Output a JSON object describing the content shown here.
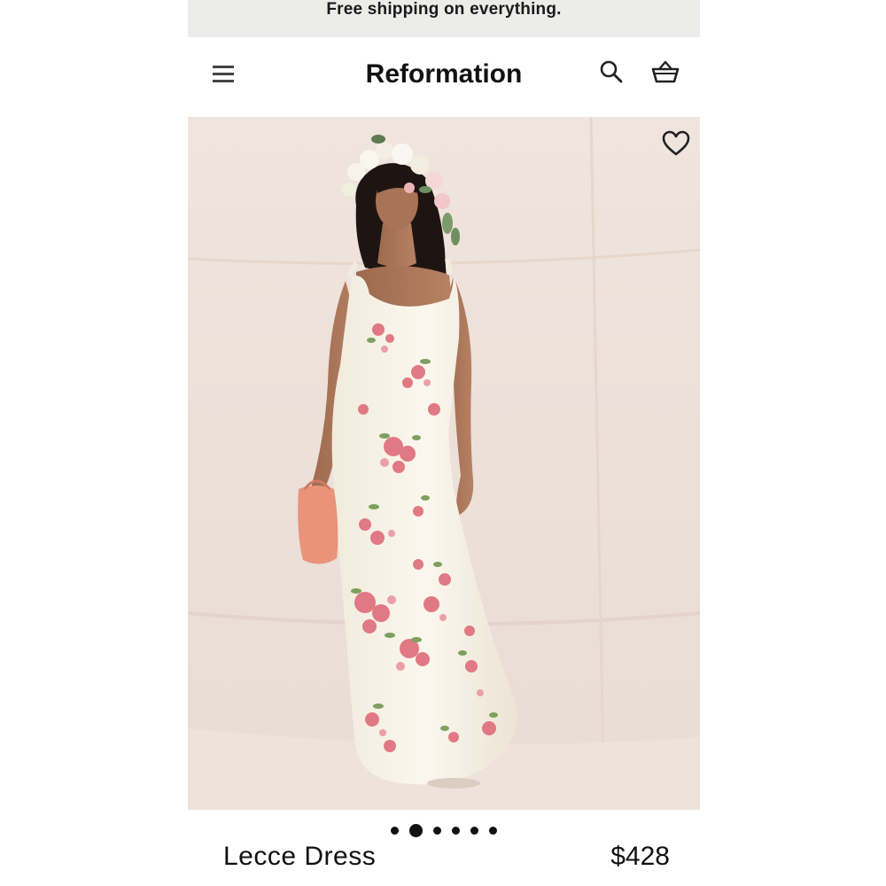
{
  "promo": {
    "text": "Free shipping on everything."
  },
  "header": {
    "brand": "Reformation",
    "icons": [
      "menu-icon",
      "search-icon",
      "bag-icon"
    ]
  },
  "hero": {
    "image": "model-in-floral-dress",
    "wishlist_icon": "heart-icon",
    "carousel": {
      "total": 6,
      "active_index": 1
    }
  },
  "product": {
    "name": "Lecce Dress",
    "price": "$428"
  },
  "colors": {
    "promo_bg": "#ececea",
    "text": "#111111",
    "hero_bg": "#efe3dc",
    "dress": "#f6f1e6",
    "floral_pink": "#e27c86",
    "floral_green": "#7fa060",
    "bag": "#e9957a"
  }
}
